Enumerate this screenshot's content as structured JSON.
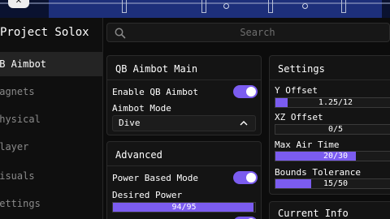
{
  "colors": {
    "accent": "#7b5cf0",
    "background": "#0c0c0c",
    "panel": "#141414"
  },
  "app": {
    "brand": "Project Solox"
  },
  "sidebar": {
    "items": [
      {
        "label": "QB Aimbot",
        "active": true
      },
      {
        "label": "Magnets"
      },
      {
        "label": "Physical"
      },
      {
        "label": "Player"
      },
      {
        "label": "Visuals"
      },
      {
        "label": "Settings"
      }
    ]
  },
  "search": {
    "placeholder": "Search",
    "icon": "search-icon"
  },
  "panels": {
    "main": {
      "title": "QB Aimbot Main",
      "enable_label": "Enable QB Aimbot",
      "enable_on": true,
      "mode_label": "Aimbot Mode",
      "mode_value": "Dive"
    },
    "advanced": {
      "title": "Advanced",
      "power_label": "Power Based Mode",
      "power_on": true,
      "desired_label": "Desired Power",
      "desired_value": "94/95",
      "desired_fraction": 0.989
    },
    "settings": {
      "title": "Settings",
      "sliders": [
        {
          "label": "Y Offset",
          "value": "1.25/12",
          "fraction": 0.104
        },
        {
          "label": "XZ Offset",
          "value": "0/5",
          "fraction": 0
        },
        {
          "label": "Max Air Time",
          "value": "20/30",
          "fraction": 0.667
        },
        {
          "label": "Bounds Tolerance",
          "value": "15/50",
          "fraction": 0.3
        }
      ]
    },
    "info": {
      "title": "Current Info"
    }
  }
}
